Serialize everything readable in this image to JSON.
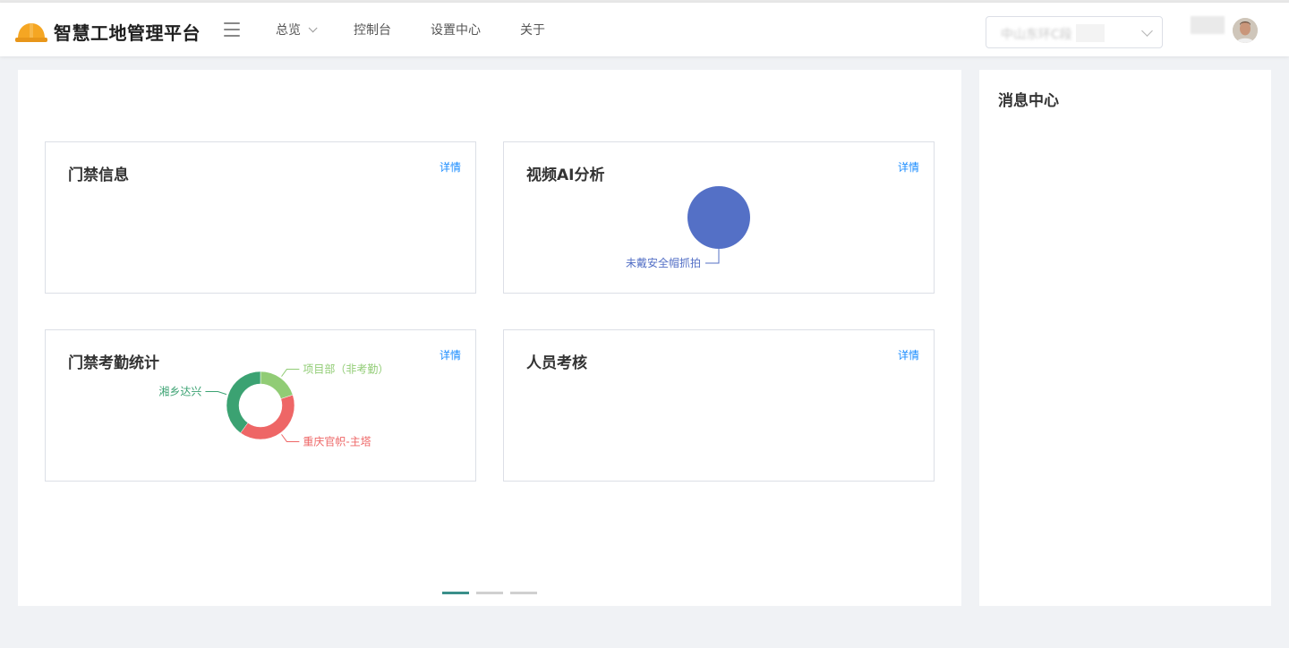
{
  "header": {
    "title": "智慧工地管理平台",
    "nav": [
      {
        "label": "总览",
        "dropdown": true
      },
      {
        "label": "控制台",
        "dropdown": false
      },
      {
        "label": "设置中心",
        "dropdown": false
      },
      {
        "label": "关于",
        "dropdown": false
      }
    ],
    "project_select": {
      "value": "中山东环C段"
    }
  },
  "cards": [
    {
      "title": "门禁信息",
      "detail": "详情"
    },
    {
      "title": "视频AI分析",
      "detail": "详情"
    },
    {
      "title": "门禁考勤统计",
      "detail": "详情"
    },
    {
      "title": "人员考核",
      "detail": "详情"
    }
  ],
  "chart_data": [
    {
      "type": "pie",
      "title": "视频AI分析",
      "slices": [
        {
          "name": "未戴安全帽抓拍",
          "value": 1,
          "color": "#5470c6"
        }
      ]
    },
    {
      "type": "pie",
      "title": "门禁考勤统计",
      "donut": true,
      "slices": [
        {
          "name": "项目部（非考勤）",
          "value": 1,
          "color": "#91cc75"
        },
        {
          "name": "重庆官帜-主塔",
          "value": 2,
          "color": "#ee6666"
        },
        {
          "name": "湘乡达兴",
          "value": 2,
          "color": "#3ba272"
        }
      ]
    }
  ],
  "pager": {
    "count": 3,
    "active": 0
  },
  "message_center": {
    "title": "消息中心"
  },
  "colors": {
    "accent": "#1a8cff",
    "logo": "#f5a623",
    "pager_active": "#3a8f8a"
  }
}
